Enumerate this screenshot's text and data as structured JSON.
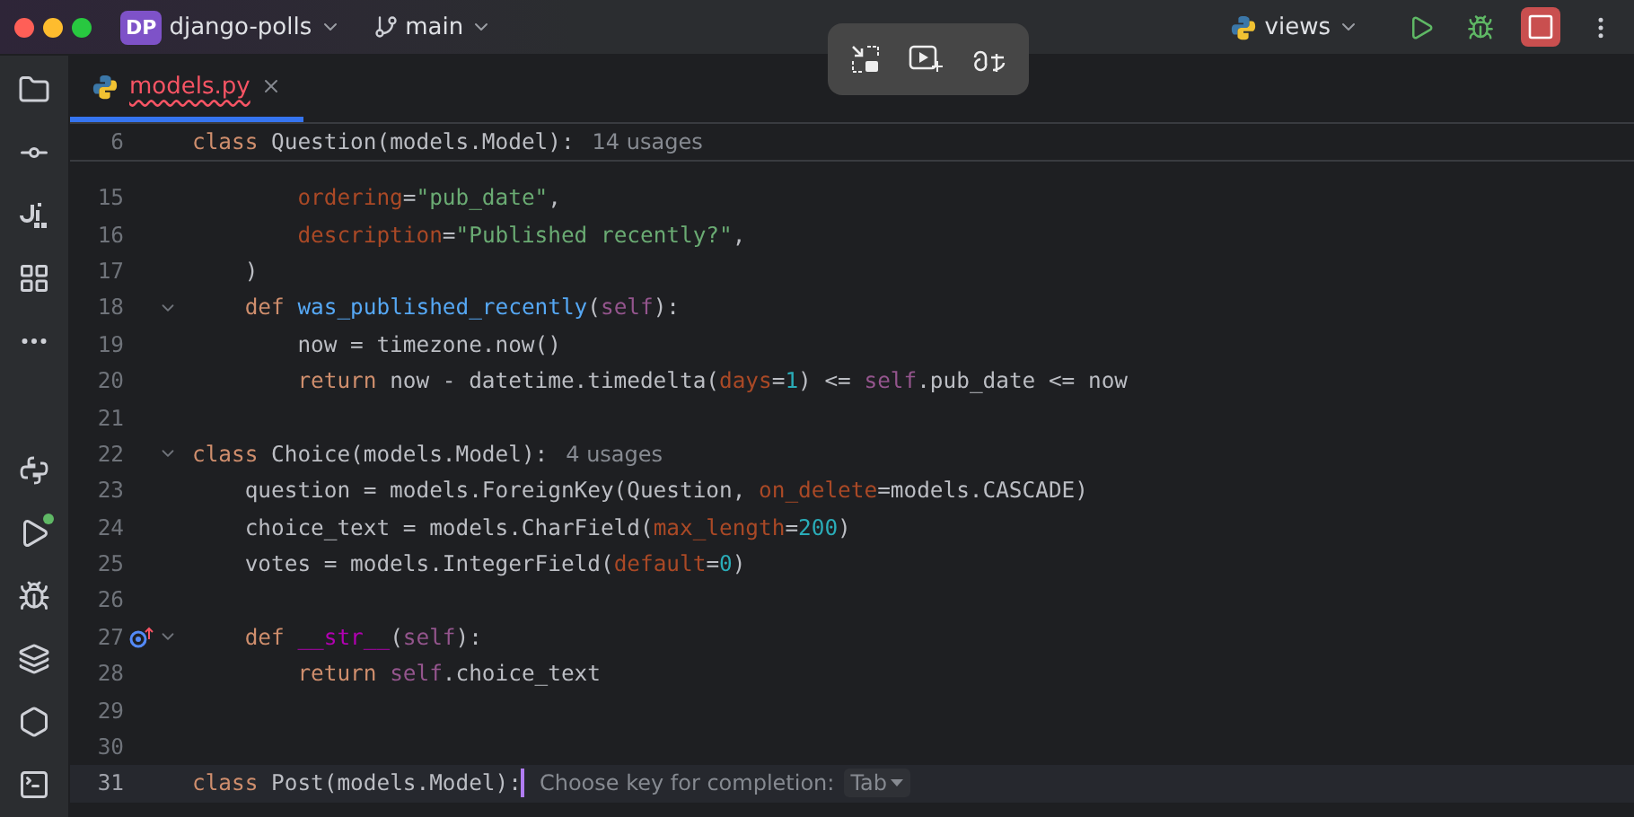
{
  "title_bar": {
    "project_badge": "DP",
    "project": "django-polls",
    "branch": "main",
    "run_config": "views"
  },
  "tabs": [
    {
      "label": "models.py",
      "selected": true,
      "has_errors": true
    }
  ],
  "sticky_line": {
    "number": "6",
    "tokens": [
      {
        "kind": "keyword",
        "text": "class "
      },
      {
        "kind": "plain",
        "text": "Question(models.Model):"
      }
    ],
    "hint": "14 usages"
  },
  "lines": [
    {
      "number": "15",
      "current": false,
      "fold": false,
      "tokens": [
        {
          "kind": "param",
          "text": "        ordering"
        },
        {
          "kind": "plain",
          "text": "="
        },
        {
          "kind": "string",
          "text": "\"pub_date\""
        },
        {
          "kind": "plain",
          "text": ","
        }
      ]
    },
    {
      "number": "16",
      "current": false,
      "fold": false,
      "tokens": [
        {
          "kind": "param",
          "text": "        description"
        },
        {
          "kind": "plain",
          "text": "="
        },
        {
          "kind": "string",
          "text": "\"Published recently?\""
        },
        {
          "kind": "plain",
          "text": ","
        }
      ]
    },
    {
      "number": "17",
      "current": false,
      "fold": false,
      "tokens": [
        {
          "kind": "plain",
          "text": "    )"
        }
      ]
    },
    {
      "number": "18",
      "current": false,
      "fold": true,
      "tokens": [
        {
          "kind": "keyword",
          "text": "    def "
        },
        {
          "kind": "function",
          "text": "was_published_recently"
        },
        {
          "kind": "plain",
          "text": "("
        },
        {
          "kind": "self",
          "text": "self"
        },
        {
          "kind": "plain",
          "text": "):"
        }
      ]
    },
    {
      "number": "19",
      "current": false,
      "fold": false,
      "tokens": [
        {
          "kind": "plain",
          "text": "        now = timezone.now()"
        }
      ]
    },
    {
      "number": "20",
      "current": false,
      "fold": false,
      "tokens": [
        {
          "kind": "keyword",
          "text": "        return "
        },
        {
          "kind": "plain",
          "text": "now - datetime.timedelta("
        },
        {
          "kind": "param",
          "text": "days"
        },
        {
          "kind": "plain",
          "text": "="
        },
        {
          "kind": "number",
          "text": "1"
        },
        {
          "kind": "plain",
          "text": ") <= "
        },
        {
          "kind": "self",
          "text": "self"
        },
        {
          "kind": "plain",
          "text": ".pub_date <= now"
        }
      ]
    },
    {
      "number": "21",
      "current": false,
      "fold": false
    },
    {
      "number": "22",
      "current": false,
      "fold": true,
      "tokens": [
        {
          "kind": "keyword",
          "text": "class "
        },
        {
          "kind": "plain",
          "text": "Choice(models.Model):"
        }
      ],
      "hint": "4 usages"
    },
    {
      "number": "23",
      "current": false,
      "fold": false,
      "tokens": [
        {
          "kind": "plain",
          "text": "    question = models.ForeignKey(Question, "
        },
        {
          "kind": "param",
          "text": "on_delete"
        },
        {
          "kind": "plain",
          "text": "=models.CASCADE)"
        }
      ]
    },
    {
      "number": "24",
      "current": false,
      "fold": false,
      "tokens": [
        {
          "kind": "plain",
          "text": "    choice_text = models.CharField("
        },
        {
          "kind": "param",
          "text": "max_length"
        },
        {
          "kind": "plain",
          "text": "="
        },
        {
          "kind": "number",
          "text": "200"
        },
        {
          "kind": "plain",
          "text": ")"
        }
      ]
    },
    {
      "number": "25",
      "current": false,
      "fold": false,
      "tokens": [
        {
          "kind": "plain",
          "text": "    votes = models.IntegerField("
        },
        {
          "kind": "param",
          "text": "default"
        },
        {
          "kind": "plain",
          "text": "="
        },
        {
          "kind": "number",
          "text": "0"
        },
        {
          "kind": "plain",
          "text": ")"
        }
      ]
    },
    {
      "number": "26",
      "current": false,
      "fold": false
    },
    {
      "number": "27",
      "current": false,
      "fold": true,
      "override": true,
      "tokens": [
        {
          "kind": "keyword",
          "text": "    def "
        },
        {
          "kind": "magic",
          "text": "__str__"
        },
        {
          "kind": "plain",
          "text": "("
        },
        {
          "kind": "self",
          "text": "self"
        },
        {
          "kind": "plain",
          "text": "):"
        }
      ]
    },
    {
      "number": "28",
      "current": false,
      "fold": false,
      "tokens": [
        {
          "kind": "keyword",
          "text": "        return "
        },
        {
          "kind": "self",
          "text": "self"
        },
        {
          "kind": "plain",
          "text": ".choice_text"
        }
      ]
    },
    {
      "number": "29",
      "current": false,
      "fold": false
    },
    {
      "number": "30",
      "current": false,
      "fold": false
    },
    {
      "number": "31",
      "current": true,
      "fold": false,
      "caret": true,
      "tokens": [
        {
          "kind": "keyword",
          "text": "class "
        },
        {
          "kind": "plain",
          "text": "Post(models.Model):"
        }
      ],
      "completion": {
        "text": "Choose key for completion:",
        "key": "Tab"
      }
    }
  ]
}
